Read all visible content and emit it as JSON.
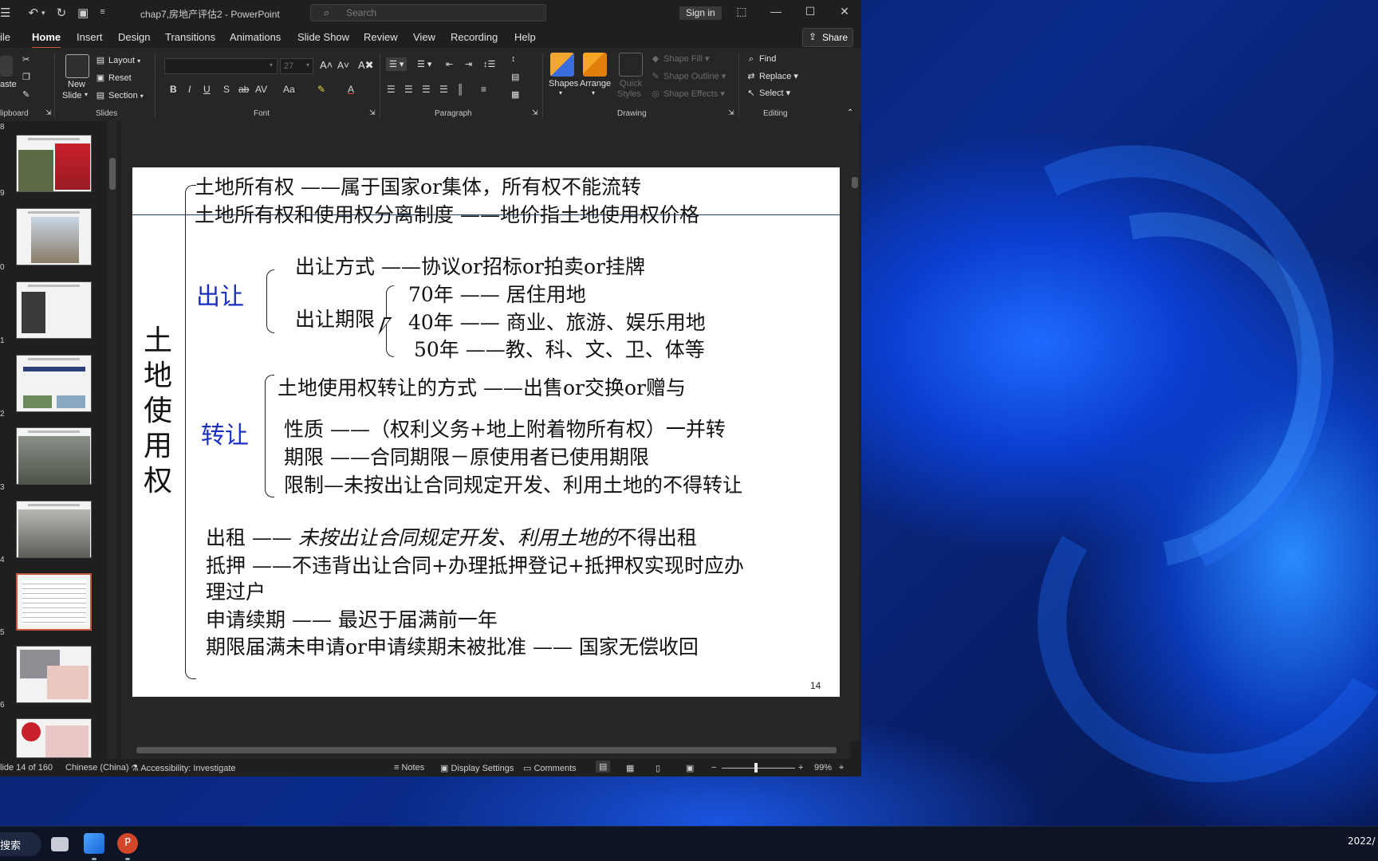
{
  "window": {
    "doc_title": "chap7,房地产评估2  -  PowerPoint",
    "search_placeholder": "Search",
    "signin_label": "Sign in",
    "share_label": "Share"
  },
  "tabs": [
    "ile",
    "Home",
    "Insert",
    "Design",
    "Transitions",
    "Animations",
    "Slide Show",
    "Review",
    "View",
    "Recording",
    "Help"
  ],
  "active_tab": "Home",
  "ribbon": {
    "groups": [
      "lipboard",
      "Slides",
      "Font",
      "Paragraph",
      "Drawing",
      "Editing"
    ],
    "clipboard": {
      "paste": "aste"
    },
    "slides": {
      "new_slide": "New",
      "new_slide2": "Slide",
      "layout": "Layout",
      "reset": "Reset",
      "section": "Section"
    },
    "font": {
      "size": "27"
    },
    "drawing": {
      "shapes": "Shapes",
      "arrange": "Arrange",
      "quick_styles": "Quick",
      "quick_styles2": "Styles",
      "shape_fill": "Shape Fill",
      "shape_outline": "Shape Outline",
      "shape_effects": "Shape Effects"
    },
    "editing": {
      "find": "Find",
      "replace": "Replace",
      "select": "Select"
    }
  },
  "thumbnails": [
    {
      "num": "8"
    },
    {
      "num": "9"
    },
    {
      "num": "0"
    },
    {
      "num": "1"
    },
    {
      "num": "2"
    },
    {
      "num": "3"
    },
    {
      "num": "4",
      "selected": true
    },
    {
      "num": "5"
    },
    {
      "num": "6"
    }
  ],
  "slide": {
    "vertical_title": [
      "土",
      "地",
      "使",
      "用",
      "权"
    ],
    "line1": "土地所有权 ——属于国家or集体，所有权不能流转",
    "line2": "土地所有权和使用权分离制度 ——地价指土地使用权价格",
    "churang": "出让",
    "churang_method": "出让方式 ——协议or招标or拍卖or挂牌",
    "churang_period": "出让期限",
    "period_70": "70年 —— 居住用地",
    "period_40": "40年 —— 商业、旅游、娱乐用地",
    "period_50": "50年 ——教、科、文、卫、体等",
    "transfer_method": "土地使用权转让的方式 ——出售or交换or赠与",
    "zhuanrang": "转让",
    "nature": "性质 ——（权利义务+地上附着物所有权）一并转",
    "term": "期限 ——合同期限－原使用者已使用期限",
    "limit": "限制—未按出让合同规定开发、利用土地的不得转让",
    "lease_prefix": "出租 —— ",
    "lease_italic": "未按出让合同规定开发、利用土地的",
    "lease_suffix": "不得出租",
    "mortgage": "抵押 ——不违背出让合同+办理抵押登记+抵押权实现时应办",
    "mortgage2": "理过户",
    "renewal": "申请续期 —— 最迟于届满前一年",
    "expiry": "期限届满未申请or申请续期未被批准 —— 国家无偿收回",
    "page_number": "14"
  },
  "statusbar": {
    "slide_info": "lide 14 of 160",
    "language": "Chinese (China)",
    "accessibility": "Accessibility: Investigate",
    "notes": "Notes",
    "display_settings": "Display Settings",
    "comments": "Comments",
    "zoom": "99%"
  },
  "taskbar": {
    "search": "搜索",
    "clock": "2022/"
  }
}
